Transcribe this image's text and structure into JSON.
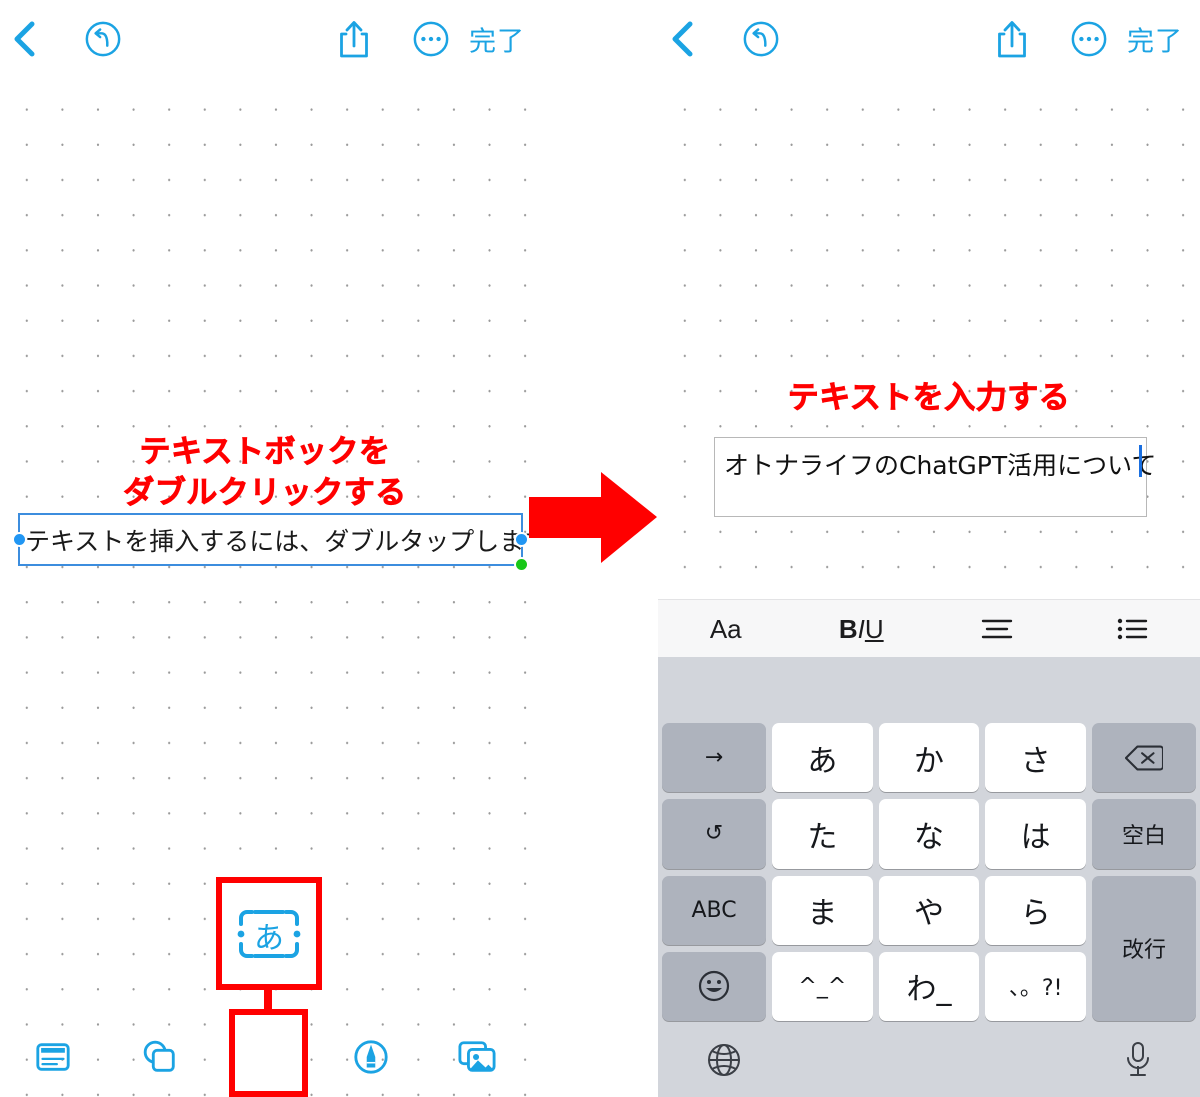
{
  "toolbar": {
    "back_icon": "chevron-left-icon",
    "undo_icon": "undo-circle-icon",
    "share_icon": "share-up-icon",
    "more_icon": "ellipsis-circle-icon",
    "done_label": "完了",
    "accent_color": "#1BA3E3"
  },
  "left_panel": {
    "annotation": {
      "line1": "テキストボックを",
      "line2": "ダブルクリックする",
      "color": "#FF0000"
    },
    "textbox": {
      "text": "テキストを挿入するには、ダブルタップします",
      "border_color": "#3C8DDE",
      "handle_color": "#2196F3",
      "rotate_handle_color": "#18C718"
    },
    "bottom_toolbar": [
      {
        "name": "document-icon",
        "label": ""
      },
      {
        "name": "shapes-icon",
        "label": ""
      },
      {
        "name": "textbox-a-icon",
        "label": "あ"
      },
      {
        "name": "pen-circle-icon",
        "label": ""
      },
      {
        "name": "media-photos-icon",
        "label": ""
      }
    ],
    "callout": {
      "magnified_icon": "textbox-a-icon",
      "highlight_color": "#FF0000"
    }
  },
  "right_panel": {
    "annotation": {
      "line1": "テキストを入力する",
      "color": "#FF0000"
    },
    "textbox": {
      "text": "オトナライフのChatGPT活用について",
      "caret_color": "#1A6FE0",
      "border_color": "#B8B8B8"
    },
    "format_bar": [
      {
        "name": "font-size-button",
        "label": "Aa"
      },
      {
        "name": "bold-italic-underline-button",
        "label": "BIU"
      },
      {
        "name": "alignment-button",
        "label": ""
      },
      {
        "name": "list-button",
        "label": ""
      }
    ],
    "keyboard": {
      "keys": [
        {
          "label": "→",
          "name": "key-arrow-right",
          "style": "dark"
        },
        {
          "label": "あ",
          "name": "key-a",
          "style": "light"
        },
        {
          "label": "か",
          "name": "key-ka",
          "style": "light"
        },
        {
          "label": "さ",
          "name": "key-sa",
          "style": "light"
        },
        {
          "label": "⌫",
          "name": "key-delete",
          "style": "dark"
        },
        {
          "label": "↺",
          "name": "key-undo",
          "style": "dark"
        },
        {
          "label": "た",
          "name": "key-ta",
          "style": "light"
        },
        {
          "label": "な",
          "name": "key-na",
          "style": "light"
        },
        {
          "label": "は",
          "name": "key-ha",
          "style": "light"
        },
        {
          "label": "空白",
          "name": "key-space",
          "style": "dark"
        },
        {
          "label": "ABC",
          "name": "key-abc",
          "style": "dark"
        },
        {
          "label": "ま",
          "name": "key-ma",
          "style": "light"
        },
        {
          "label": "や",
          "name": "key-ya",
          "style": "light"
        },
        {
          "label": "ら",
          "name": "key-ra",
          "style": "light"
        },
        {
          "label": "改行",
          "name": "key-return",
          "style": "dark"
        },
        {
          "label": "☺",
          "name": "key-emoji",
          "style": "dark"
        },
        {
          "label": "^_^",
          "name": "key-kaomoji",
          "style": "light"
        },
        {
          "label": "わ_",
          "name": "key-wa",
          "style": "light"
        },
        {
          "label": "、。?!",
          "name": "key-punctuation",
          "style": "light"
        }
      ],
      "globe_icon": "globe-icon",
      "mic_icon": "microphone-icon",
      "background_color": "#D2D5DB"
    }
  },
  "arrow": {
    "name": "red-right-arrow",
    "color": "#FF0000"
  }
}
